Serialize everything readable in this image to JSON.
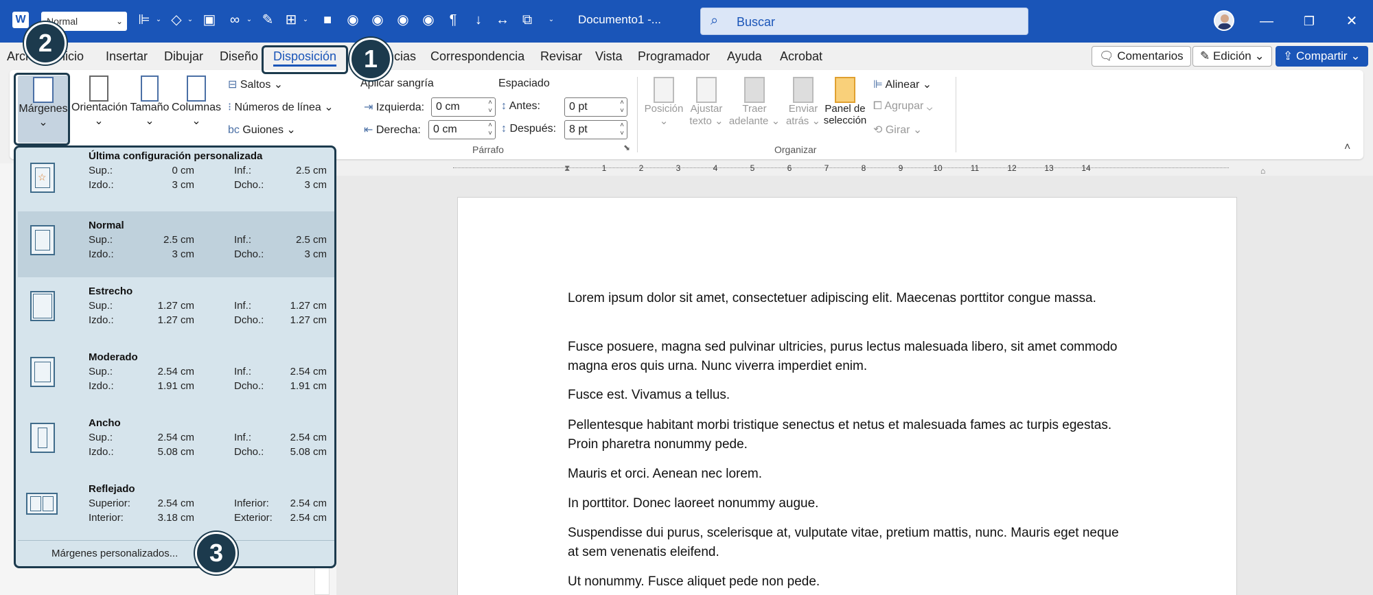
{
  "app": {
    "style_combo": "Normal",
    "doc_title": "Documento1  -...",
    "search_placeholder": "Buscar"
  },
  "tabs": [
    "Archivo",
    "Inicio",
    "Insertar",
    "Dibujar",
    "Diseño",
    "Disposición",
    "Referencias",
    "Correspondencia",
    "Revisar",
    "Vista",
    "Programador",
    "Ayuda",
    "Acrobat"
  ],
  "top_buttons": {
    "comments": "Comentarios",
    "editing": "Edición",
    "share": "Compartir"
  },
  "ribbon": {
    "margins": "Márgenes",
    "orientation": "Orientación",
    "size": "Tamaño",
    "columns": "Columnas",
    "breaks": "Saltos",
    "line_numbers": "Números de línea",
    "hyphenation": "Guiones",
    "indent_title": "Aplicar sangría",
    "spacing_title": "Espaciado",
    "left_label": "Izquierda:",
    "left_value": "0 cm",
    "right_label": "Derecha:",
    "right_value": "0 cm",
    "before_label": "Antes:",
    "before_value": "0 pt",
    "after_label": "Después:",
    "after_value": "8 pt",
    "paragraph_group": "Párrafo",
    "position": "Posición",
    "wrap_text_1": "Ajustar",
    "wrap_text_2": "texto",
    "bring_forward_1": "Traer",
    "bring_forward_2": "adelante",
    "send_backward_1": "Enviar",
    "send_backward_2": "atrás",
    "selection_pane_1": "Panel de",
    "selection_pane_2": "selección",
    "align": "Alinear",
    "group": "Agrupar",
    "rotate": "Girar",
    "arrange_group": "Organizar"
  },
  "ruler": [
    "1",
    "2",
    "3",
    "4",
    "5",
    "6",
    "7",
    "8",
    "9",
    "10",
    "11",
    "12",
    "13",
    "14"
  ],
  "gallery": {
    "items": [
      {
        "title": "Última configuración personalizada",
        "l1": "Sup.:",
        "v1": "0 cm",
        "l2": "Inf.:",
        "v2": "2.5 cm",
        "l3": "Izdo.:",
        "v3": "3 cm",
        "l4": "Dcho.:",
        "v4": "3 cm"
      },
      {
        "title": "Normal",
        "l1": "Sup.:",
        "v1": "2.5 cm",
        "l2": "Inf.:",
        "v2": "2.5 cm",
        "l3": "Izdo.:",
        "v3": "3 cm",
        "l4": "Dcho.:",
        "v4": "3 cm"
      },
      {
        "title": "Estrecho",
        "l1": "Sup.:",
        "v1": "1.27 cm",
        "l2": "Inf.:",
        "v2": "1.27 cm",
        "l3": "Izdo.:",
        "v3": "1.27 cm",
        "l4": "Dcho.:",
        "v4": "1.27 cm"
      },
      {
        "title": "Moderado",
        "l1": "Sup.:",
        "v1": "2.54 cm",
        "l2": "Inf.:",
        "v2": "2.54 cm",
        "l3": "Izdo.:",
        "v3": "1.91 cm",
        "l4": "Dcho.:",
        "v4": "1.91 cm"
      },
      {
        "title": "Ancho",
        "l1": "Sup.:",
        "v1": "2.54 cm",
        "l2": "Inf.:",
        "v2": "2.54 cm",
        "l3": "Izdo.:",
        "v3": "5.08 cm",
        "l4": "Dcho.:",
        "v4": "5.08 cm"
      },
      {
        "title": "Reflejado",
        "l1": "Superior:",
        "v1": "2.54 cm",
        "l2": "Inferior:",
        "v2": "2.54 cm",
        "l3": "Interior:",
        "v3": "3.18 cm",
        "l4": "Exterior:",
        "v4": "2.54 cm"
      }
    ],
    "custom": "Márgenes personalizados..."
  },
  "document": {
    "paragraphs": [
      "Lorem ipsum dolor sit amet, consectetuer adipiscing elit. Maecenas porttitor congue massa.",
      "Fusce posuere, magna sed pulvinar ultricies, purus lectus malesuada libero, sit amet commodo magna eros quis urna. Nunc viverra imperdiet enim.",
      "Fusce est. Vivamus a tellus.",
      "Pellentesque habitant morbi tristique senectus et netus et malesuada fames ac turpis egestas. Proin pharetra nonummy pede.",
      "Mauris et orci. Aenean nec lorem.",
      "In porttitor. Donec laoreet nonummy augue.",
      "Suspendisse dui purus, scelerisque at, vulputate vitae, pretium mattis, nunc. Mauris eget neque at sem venenatis eleifend.",
      "Ut nonummy. Fusce aliquet pede non pede."
    ]
  },
  "callouts": [
    "1",
    "2",
    "3"
  ],
  "colors": {
    "title_bar": "#1a55b8",
    "callout": "#1c3a4d",
    "gallery_bg": "#d6e4ec"
  }
}
